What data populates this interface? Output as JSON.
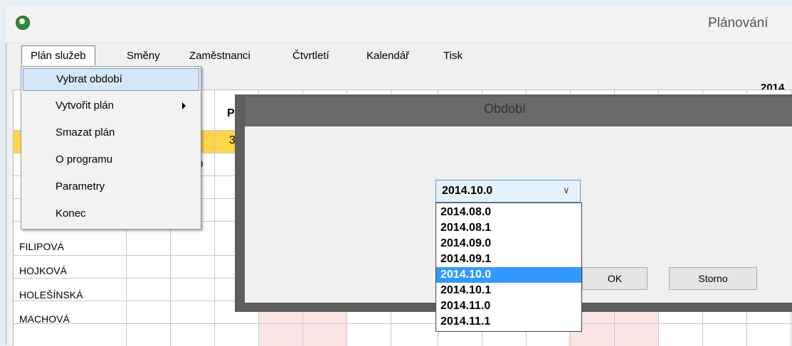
{
  "window": {
    "title": "Plánování"
  },
  "menubar": [
    "Plán služeb",
    "Směny",
    "Zaměstnanci",
    "Čtvrtletí",
    "Kalendář",
    "Tisk"
  ],
  "plan_menu": [
    {
      "label": "Vybrat období",
      "submenu": false
    },
    {
      "label": "Vytvořit plán",
      "submenu": true
    },
    {
      "label": "Smazat plán",
      "submenu": false
    },
    {
      "label": "O programu",
      "submenu": false
    },
    {
      "label": "Parametry",
      "submenu": false
    },
    {
      "label": "Konec",
      "submenu": false
    }
  ],
  "grid": {
    "year_label": "2014",
    "header_fragment": "P",
    "yellow_fragment": "3",
    "cell_fragment": "0",
    "names": [
      "FILIPOVÁ",
      "HOJKOVÁ",
      "HOLEŠÍNSKÁ",
      "MACHOVÁ"
    ],
    "colors": {
      "highlight_row": "#ffd54a",
      "pink_cells": "#fbe5e5"
    }
  },
  "dialog": {
    "title": "Období",
    "combo_value": "2014.10.0",
    "options": [
      "2014.08.0",
      "2014.08.1",
      "2014.09.0",
      "2014.09.1",
      "2014.10.0",
      "2014.10.1",
      "2014.11.0",
      "2014.11.1"
    ],
    "selected_option": "2014.10.0",
    "ok_label": "OK",
    "cancel_label": "Storno"
  }
}
